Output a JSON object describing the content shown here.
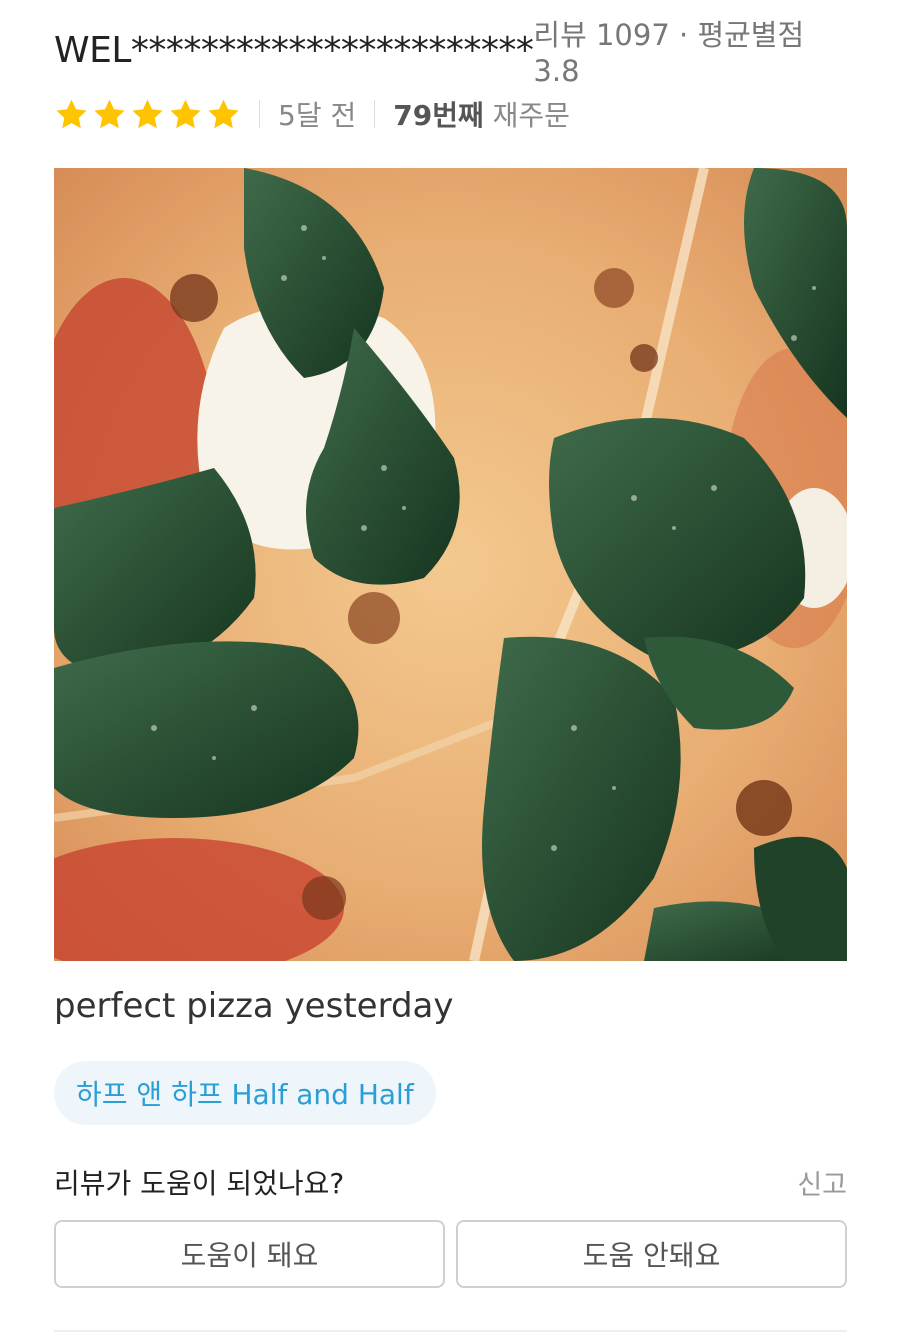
{
  "review": {
    "reviewer_name": "WEL***********************",
    "reviewer_stats": "리뷰 1097 · 평균별점 3.8",
    "rating": 5,
    "rating_max": 5,
    "time_ago": "5달 전",
    "reorder_count": "79번째",
    "reorder_suffix": "재주문",
    "photo_subject": "pizza with spinach and mozzarella",
    "text": "perfect pizza yesterday",
    "menu_item": "하프 앤 하프 Half and Half"
  },
  "helpful": {
    "question": "리뷰가 도움이 되었나요?",
    "report_label": "신고",
    "yes_label": "도움이 돼요",
    "no_label": "도움 안돼요"
  },
  "colors": {
    "star": "#FFC400",
    "menu_chip_text": "#2a9fd6",
    "menu_chip_bg": "#eef6fb"
  },
  "icons": {
    "star": "star-icon"
  }
}
